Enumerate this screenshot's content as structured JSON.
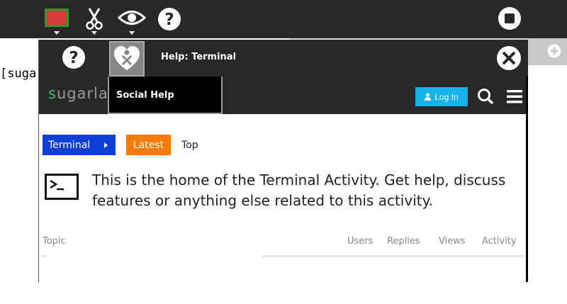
{
  "toolbar": {
    "buttons": [
      {
        "icon": "flag-icon"
      },
      {
        "icon": "scissors-icon"
      },
      {
        "icon": "eye-icon"
      },
      {
        "icon": "help-icon"
      }
    ],
    "stop_icon": "stop-icon"
  },
  "background": {
    "text": "[sugar"
  },
  "help_window": {
    "title": "Help: Terminal",
    "palette_label": "Social Help",
    "site": {
      "logo": "sugarlab",
      "login_label": "Log In",
      "category_label": "Terminal",
      "latest_label": "Latest",
      "top_label": "Top",
      "description": "This is the home of the Terminal Activity. Get help, discuss features or anything else related to this activity.",
      "columns": [
        "Topic",
        "Users",
        "Replies",
        "Views",
        "Activity"
      ]
    }
  },
  "colors": {
    "toolbar_bg": "#282828",
    "login_bg": "#17b3e8",
    "category_bg": "#0f3fd6",
    "latest_bg": "#f57c0c",
    "logo_green": "#3bbf5b"
  }
}
